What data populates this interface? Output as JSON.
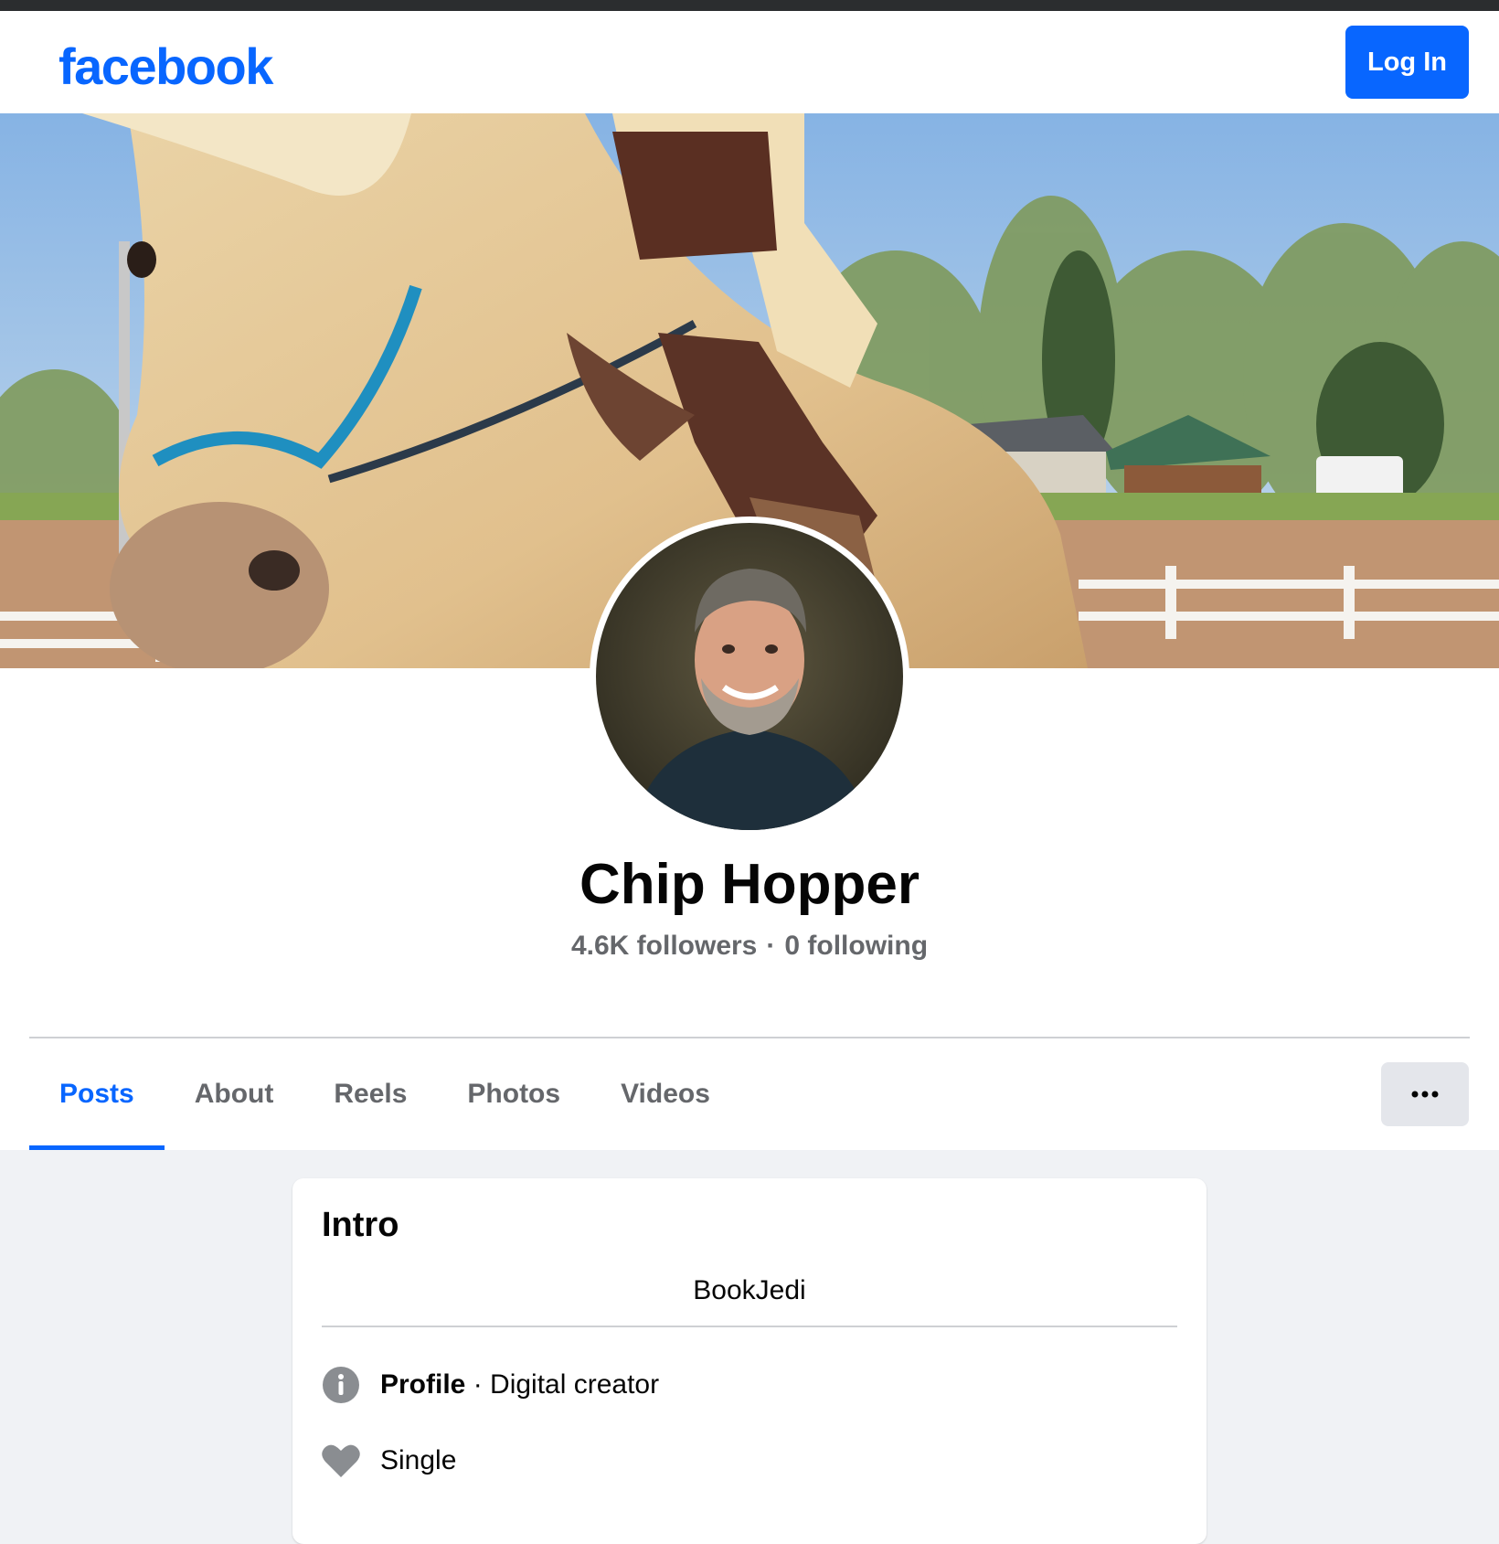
{
  "header": {
    "logo_text": "facebook",
    "login_label": "Log In"
  },
  "profile": {
    "name": "Chip Hopper",
    "followers": "4.6K followers",
    "separator": "·",
    "following": "0 following"
  },
  "tabs": [
    {
      "label": "Posts",
      "active": true
    },
    {
      "label": "About",
      "active": false
    },
    {
      "label": "Reels",
      "active": false
    },
    {
      "label": "Photos",
      "active": false
    },
    {
      "label": "Videos",
      "active": false
    }
  ],
  "more_icon": "more-horizontal-icon",
  "intro": {
    "title": "Intro",
    "bio": "BookJedi",
    "category_label": "Profile",
    "category_separator": " · ",
    "category_value": "Digital creator",
    "relationship": "Single"
  },
  "colors": {
    "brand_blue": "#0866ff",
    "page_bg": "#f0f2f5",
    "secondary_text": "#65676b"
  }
}
